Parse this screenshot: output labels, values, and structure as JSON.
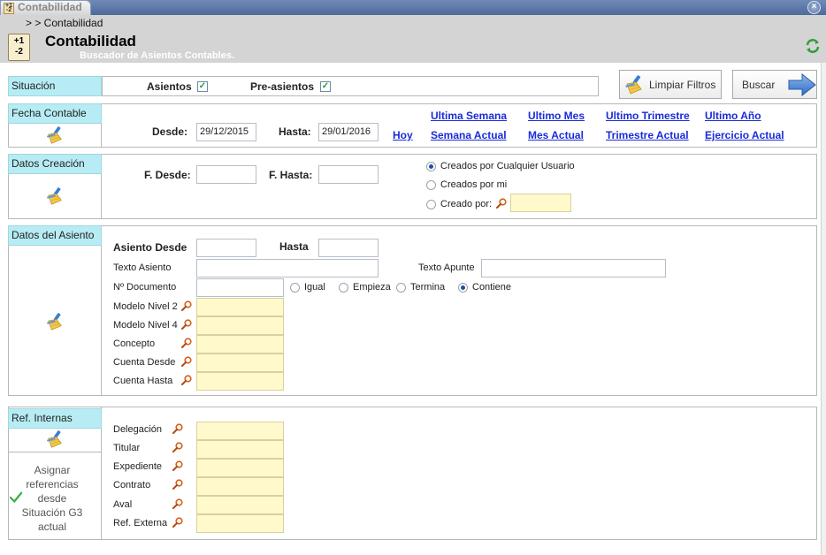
{
  "window": {
    "tab_title": "Contabilidad",
    "tab_icon_text": "+1 -2",
    "close_glyph": "×"
  },
  "header": {
    "breadcrumb": ">  > Contabilidad",
    "icon_text": "+1 -2",
    "title": "Contabilidad",
    "subtitle": "Buscador de Asientos Contables.",
    "refresh_icon": "refresh-icon"
  },
  "situacion": {
    "label": "Situación",
    "asientos_label": "Asientos",
    "asientos_checked": true,
    "preasientos_label": "Pre-asientos",
    "preasientos_checked": true
  },
  "toolbar": {
    "clear_label": "Limpiar Filtros",
    "search_label": "Buscar"
  },
  "fecha_contable": {
    "label": "Fecha Contable",
    "desde_label": "Desde:",
    "desde_value": "29/12/2015",
    "hasta_label": "Hasta:",
    "hasta_value": "29/01/2016",
    "hoy": "Hoy",
    "links": {
      "ultima_semana": "Ultima Semana ",
      "ultimo_mes": "Ultimo Mes",
      "ultimo_trimestre": "Ultimo Trimestre",
      "ultimo_ano": "Ultimo Año",
      "semana_actual": "Semana Actual",
      "mes_actual": "Mes Actual",
      "trimestre_actual": "Trimestre Actual",
      "ejercicio_actual": "Ejercicio Actual"
    }
  },
  "datos_creacion": {
    "label": "Datos Creación",
    "f_desde_label": "F. Desde:",
    "f_desde_value": "",
    "f_hasta_label": "F. Hasta:",
    "f_hasta_value": "",
    "radios": [
      {
        "label": "Creados por Cualquier Usuario",
        "selected": true
      },
      {
        "label": "Creados por mi",
        "selected": false
      },
      {
        "label": "Creado por:",
        "selected": false
      }
    ],
    "creado_por_value": ""
  },
  "datos_asiento": {
    "label": "Datos del Asiento",
    "asiento_desde_label": "Asiento Desde",
    "asiento_desde_value": "",
    "hasta_label": "Hasta",
    "hasta_value": "",
    "texto_asiento_label": "Texto Asiento",
    "texto_asiento_value": "",
    "texto_apunte_label": "Texto Apunte",
    "texto_apunte_value": "",
    "n_documento_label": "Nº Documento",
    "n_documento_value": "",
    "match_options": [
      {
        "label": "Igual",
        "selected": false
      },
      {
        "label": "Empieza",
        "selected": false
      },
      {
        "label": "Termina",
        "selected": false
      },
      {
        "label": "Contiene",
        "selected": true
      }
    ],
    "lookup_fields": [
      {
        "label": "Modelo Nivel 2",
        "value": ""
      },
      {
        "label": "Modelo Nivel 4",
        "value": ""
      },
      {
        "label": "Concepto",
        "value": ""
      },
      {
        "label": "Cuenta Desde",
        "value": ""
      },
      {
        "label": "Cuenta Hasta",
        "value": ""
      }
    ]
  },
  "ref_internas": {
    "label": "Ref. Internas",
    "assign_text": "Asignar referencias desde Situación G3 actual",
    "lookup_fields": [
      {
        "label": "Delegación",
        "value": ""
      },
      {
        "label": "Titular",
        "value": ""
      },
      {
        "label": "Expediente",
        "value": ""
      },
      {
        "label": "Contrato",
        "value": ""
      },
      {
        "label": "Aval",
        "value": ""
      },
      {
        "label": "Ref. Externa",
        "value": ""
      }
    ]
  },
  "colors": {
    "label_bg": "#b7ecf4",
    "link": "#1a2bd9",
    "lookup_bg": "#fff9cc",
    "header_bg": "#d4d4d4",
    "tabbar_bg": "#5b76a6"
  }
}
